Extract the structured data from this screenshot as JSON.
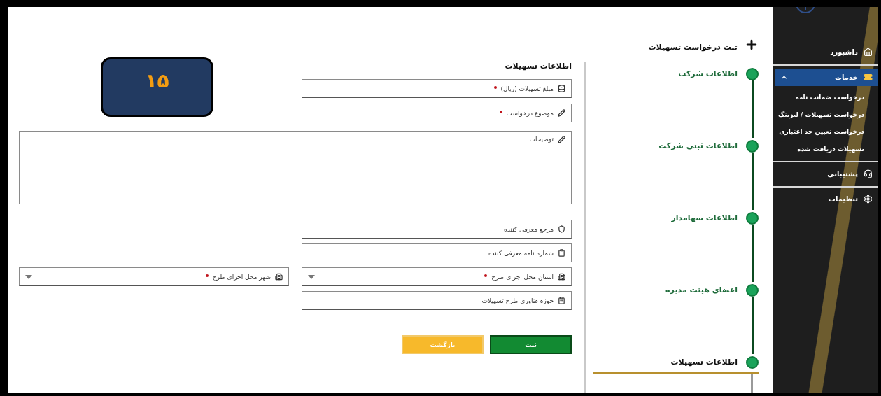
{
  "sidebar": {
    "items": [
      {
        "label": "داشبورد",
        "selected": false,
        "expanded": false
      },
      {
        "label": "خدمات",
        "selected": true,
        "expanded": true,
        "children": [
          {
            "label": "درخواست ضمانت نامه",
            "selected": false
          },
          {
            "label": "درخواست تسهیلات / لیزینگ",
            "selected": false
          },
          {
            "label": "درخواست تعیین حد اعتباری",
            "selected": false
          },
          {
            "label": "تسهیلات دریافت شده",
            "selected": false
          }
        ]
      },
      {
        "label": "پشتیبانی",
        "selected": false,
        "expanded": false
      },
      {
        "label": "تنظیمات",
        "selected": false,
        "expanded": false
      }
    ]
  },
  "steps_panel": {
    "title": "ثبت درخواست تسهیلات",
    "steps": [
      {
        "label": "اطلاعات شرکت",
        "selected": false
      },
      {
        "label": "اطلاعات ثبتی شرکت",
        "selected": false
      },
      {
        "label": "اطلاعات سهامدار",
        "selected": false
      },
      {
        "label": "اعضای هیئت مدیره",
        "selected": false
      },
      {
        "label": "اطلاعات تسهیلات",
        "selected": true
      }
    ]
  },
  "form": {
    "title": "اطلاعات تسهیلات",
    "badge": "۱۵",
    "top_rows": [
      [
        {
          "label": "مبلغ تسهیلات (ریال)",
          "kind": "text",
          "required": true
        }
      ],
      [
        {
          "label": "موضوع درخواست",
          "kind": "text",
          "required": true
        }
      ]
    ],
    "description": {
      "label": "توضیحات"
    },
    "bottom_rows": [
      [
        {
          "label": "مرجع معرفی کننده",
          "kind": "text",
          "required": false
        }
      ],
      [
        {
          "label": "شماره نامه معرفی کننده",
          "kind": "text",
          "required": false
        }
      ],
      [
        {
          "label": "استان محل اجرای طرح",
          "kind": "select",
          "required": true
        },
        {
          "label": "شهر محل اجرای طرح",
          "kind": "select",
          "required": true
        }
      ],
      [
        {
          "label": "حوزه فناوری طرح تسهیلات",
          "kind": "text",
          "required": false
        }
      ]
    ],
    "buttons": [
      {
        "label": "ثبت",
        "kind": "primary"
      },
      {
        "label": "بازگشت",
        "kind": "secondary"
      }
    ]
  }
}
